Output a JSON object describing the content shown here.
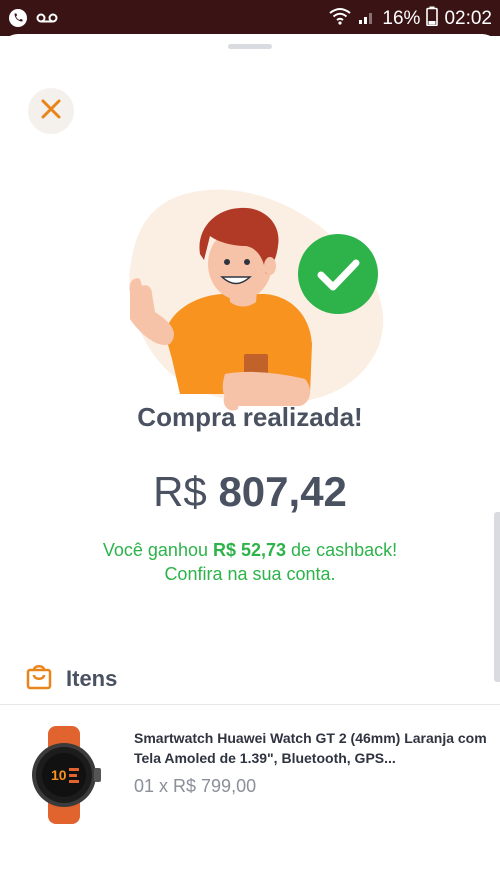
{
  "status_bar": {
    "battery_percent": "16%",
    "time": "02:02"
  },
  "title": "Compra realizada!",
  "amount": {
    "currency": "R$",
    "value": "807,42"
  },
  "cashback": {
    "prefix": "Você ganhou ",
    "amount": "R$ 52,73",
    "suffix": " de cashback!",
    "line2": "Confira na sua conta."
  },
  "items_section": {
    "label": "Itens",
    "items": [
      {
        "name": "Smartwatch Huawei Watch GT 2 (46mm) Laranja com Tela Amoled de 1.39\", Bluetooth, GPS...",
        "quantity_price": "01 x R$ 799,00"
      }
    ]
  },
  "colors": {
    "accent_orange": "#e8841a",
    "success_green": "#2db34a",
    "text_dark": "#4a5160"
  }
}
